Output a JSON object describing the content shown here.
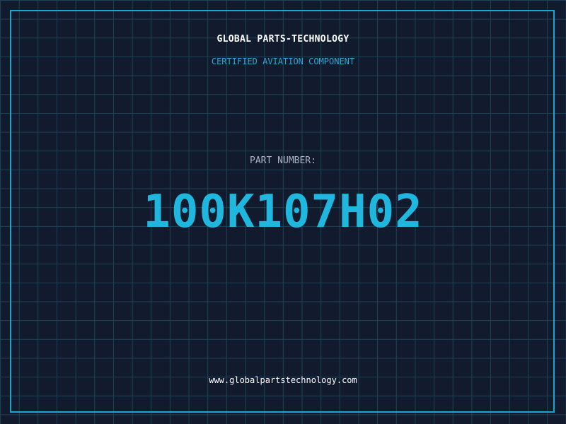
{
  "header": {
    "company": "GLOBAL PARTS-TECHNOLOGY",
    "tagline": "CERTIFIED AVIATION COMPONENT"
  },
  "part": {
    "label": "PART NUMBER:",
    "number": "100K107H02"
  },
  "footer": {
    "website": "www.globalpartstechnology.com"
  },
  "colors": {
    "background": "#121a2e",
    "grid": "#1d4257",
    "accent": "#1fb7de",
    "frame": "#1aa7cf"
  }
}
